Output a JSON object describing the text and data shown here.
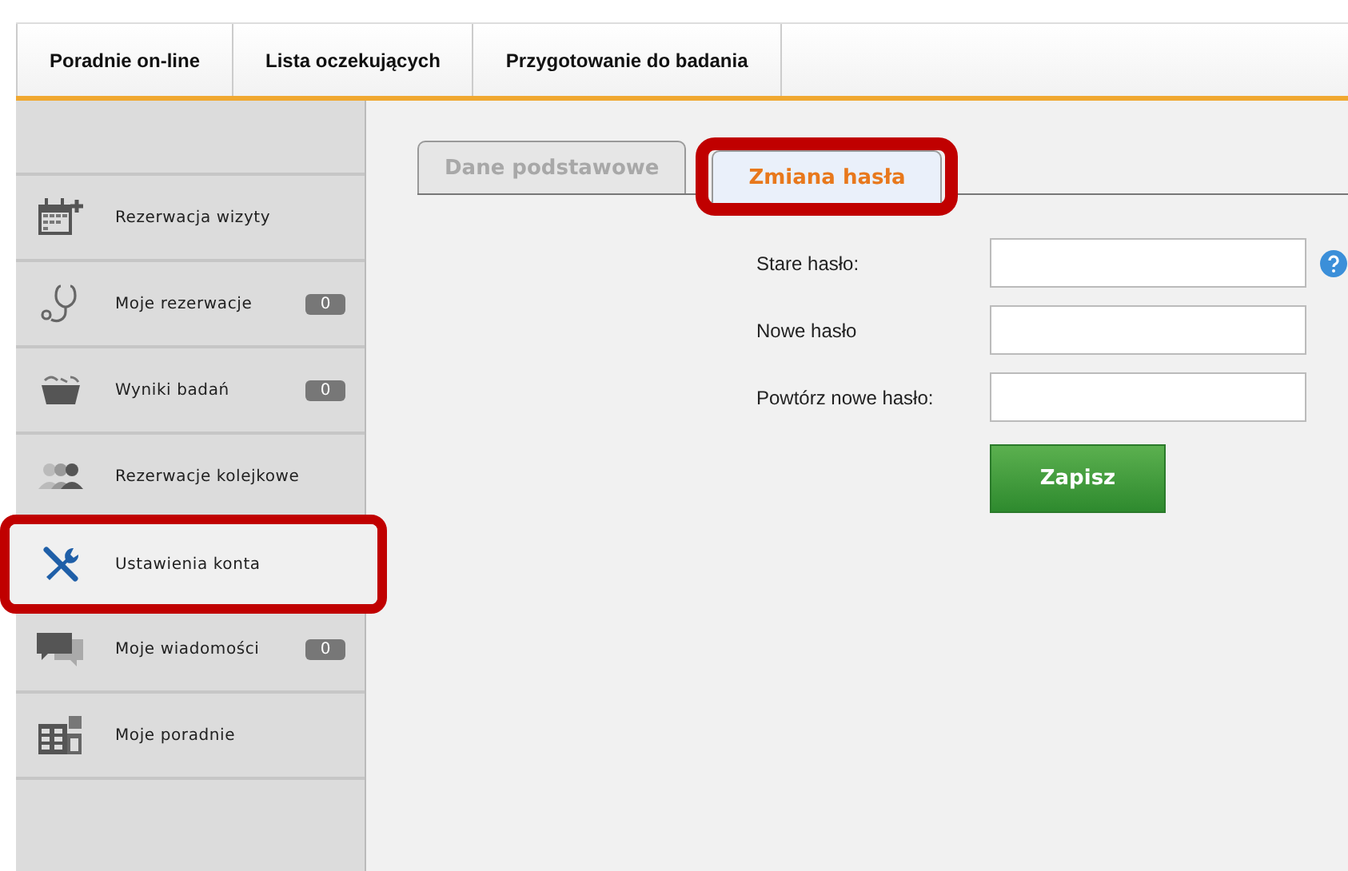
{
  "top_nav": [
    {
      "label": "Poradnie on-line",
      "selected": false
    },
    {
      "label": "Lista oczekujących",
      "selected": false
    },
    {
      "label": "Przygotowanie do badania",
      "selected": false
    }
  ],
  "sidebar": {
    "items": [
      {
        "label": "Rezerwacja wizyty",
        "selected": false,
        "highlighted": false
      },
      {
        "label": "Moje rezerwacje",
        "badge": "0",
        "selected": false,
        "highlighted": false
      },
      {
        "label": "Wyniki badań",
        "badge": "0",
        "selected": false,
        "highlighted": false
      },
      {
        "label": "Rezerwacje kolejkowe",
        "selected": false,
        "highlighted": false
      },
      {
        "label": "Ustawienia konta",
        "selected": true,
        "highlighted": true
      },
      {
        "label": "Moje wiadomości",
        "badge": "0",
        "selected": false,
        "highlighted": false
      },
      {
        "label": "Moje poradnie",
        "selected": false,
        "highlighted": false
      }
    ]
  },
  "tabs": [
    {
      "label": "Dane podstawowe",
      "selected": false,
      "highlighted": false
    },
    {
      "label": "Zmiana hasła",
      "selected": true,
      "highlighted": true
    }
  ],
  "form": {
    "fields": [
      {
        "label": "Stare hasło:",
        "help": true
      },
      {
        "label": "Nowe hasło",
        "help": false
      },
      {
        "label": "Powtórz nowe hasło:",
        "help": false
      }
    ],
    "submit": "Zapisz"
  }
}
